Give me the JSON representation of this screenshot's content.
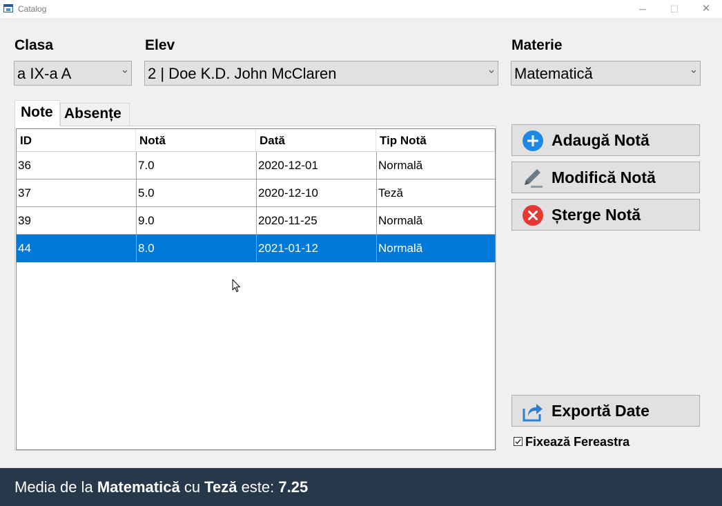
{
  "window": {
    "title": "Catalog",
    "minimize": "─",
    "maximize": "☐",
    "close": "✕"
  },
  "filters": {
    "clasa": {
      "label": "Clasa",
      "value": "a IX-a A"
    },
    "elev": {
      "label": "Elev",
      "value": "2 | Doe K.D. John McClaren"
    },
    "materie": {
      "label": "Materie",
      "value": "Matematică"
    }
  },
  "tabs": [
    {
      "label": "Note"
    },
    {
      "label": "Absențe"
    }
  ],
  "grid": {
    "columns": [
      "ID",
      "Notă",
      "Dată",
      "Tip Notă"
    ],
    "rows": [
      [
        "36",
        "7.0",
        "2020-12-01",
        "Normală"
      ],
      [
        "37",
        "5.0",
        "2020-12-10",
        "Teză"
      ],
      [
        "39",
        "9.0",
        "2020-11-25",
        "Normală"
      ],
      [
        "44",
        "8.0",
        "2021-01-12",
        "Normală"
      ]
    ],
    "selected_row_index": 3
  },
  "actions": {
    "add": {
      "label": "Adaugă Notă",
      "icon": "plus-circle-icon",
      "color": "#1e88e5"
    },
    "edit": {
      "label": "Modifică Notă",
      "icon": "pencil-icon",
      "color": "#6b7a86"
    },
    "delete": {
      "label": "Șterge Notă",
      "icon": "x-circle-icon",
      "color": "#e53935"
    },
    "export": {
      "label": "Exportă Date",
      "icon": "share-icon",
      "color": "#2f7fcf"
    }
  },
  "pin_window": {
    "label": "Fixează Fereastra",
    "checked": true
  },
  "status": {
    "prefix": "Media de la ",
    "subject": "Matematică",
    "middle": " cu ",
    "type": "Teză",
    "suffix": " este: ",
    "value": "7.25"
  }
}
